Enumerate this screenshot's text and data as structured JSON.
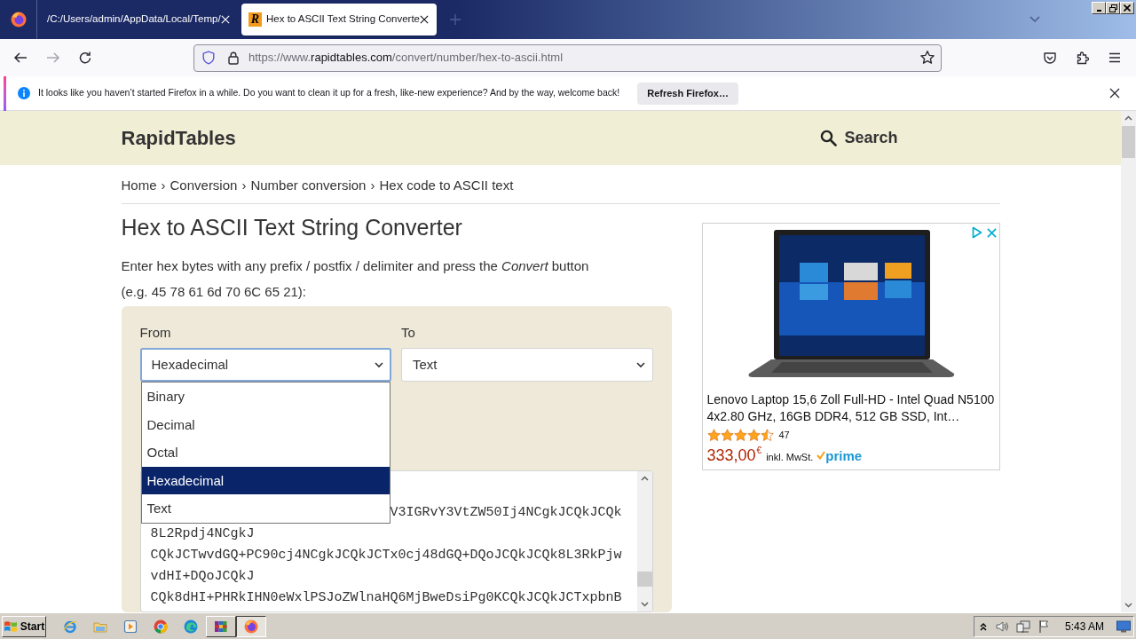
{
  "browser": {
    "tabs": [
      {
        "title": "/C:/Users/admin/AppData/Local/Temp/",
        "selected": false
      },
      {
        "favicon": "R",
        "title": "Hex to ASCII Text String Converte",
        "selected": true
      }
    ],
    "address": {
      "scheme": "https://www.",
      "domain": "rapidtables.com",
      "path": "/convert/number/hex-to-ascii.html"
    },
    "notification": {
      "message": "It looks like you haven’t started Firefox in a while. Do you want to clean it up for a fresh, like-new experience? And by the way, welcome back!",
      "button": "Refresh Firefox…"
    }
  },
  "page": {
    "header": {
      "logo": "RapidTables",
      "search": "Search"
    },
    "breadcrumb": [
      {
        "label": "Home",
        "separator": "›"
      },
      {
        "label": "Conversion",
        "separator": "›"
      },
      {
        "label": "Number conversion",
        "separator": "›"
      },
      {
        "label": "Hex code to ASCII text"
      }
    ],
    "title": "Hex to ASCII Text String Converter",
    "intro": "Enter hex bytes with any prefix / postfix / delimiter and press the *Convert* button",
    "example": "(e.g. 45 78 61 6d 70 6C 65 21):",
    "converter": {
      "from": {
        "label": "From",
        "value": "Hexadecimal",
        "open": true,
        "options": [
          {
            "label": "Binary",
            "selected": false
          },
          {
            "label": "Decimal",
            "selected": false
          },
          {
            "label": "Octal",
            "selected": false
          },
          {
            "label": "Hexadecimal",
            "selected": true
          },
          {
            "label": "Text",
            "selected": false
          }
        ]
      },
      "to": {
        "label": "To",
        "value": "Text",
        "open": false
      },
      "input_lines": [
        {
          "kind": "covered",
          "text": "V3IGRvY3VtZW50Ij4NCgkJCQkJCQk"
        },
        {
          "kind": "full",
          "text": "8L2Rpdj4NCgkJ"
        },
        {
          "kind": "full",
          "text": "CQkJCTwvdGQ+PC90cj4NCgkJCQkJCTx0cj48dGQ+DQoJCQkJCQk8L3RkPjw"
        },
        {
          "kind": "full",
          "text": "vdHI+DQoJCQkJ"
        },
        {
          "kind": "full",
          "text": "CQk8dHI+PHRkIHN0eWxlPSJoZWlnaHQ6MjBweDsiPg0KCQkJCQkJCTxpbnB"
        }
      ]
    },
    "ad": {
      "title": "Lenovo Laptop 15,6 Zoll Full-HD - Intel Quad N5100 4x2.80 GHz, 16GB DDR4, 512 GB SSD, Int…",
      "stars": 4.5,
      "reviews": "47",
      "price": "333,00",
      "currency": "€",
      "tax_note": "inkl. MwSt.",
      "prime": "prime"
    }
  },
  "taskbar": {
    "start": "Start",
    "apps": [
      {
        "kind": "ie",
        "running": false,
        "selected": false
      },
      {
        "kind": "folder",
        "running": false,
        "selected": false
      },
      {
        "kind": "media",
        "running": false,
        "selected": false
      },
      {
        "kind": "chrome",
        "running": false,
        "selected": false
      },
      {
        "kind": "edge",
        "running": false,
        "selected": false
      },
      {
        "kind": "archive",
        "running": true,
        "selected": false
      },
      {
        "kind": "firefox",
        "running": true,
        "selected": true
      }
    ],
    "clock": "5:43 AM"
  }
}
